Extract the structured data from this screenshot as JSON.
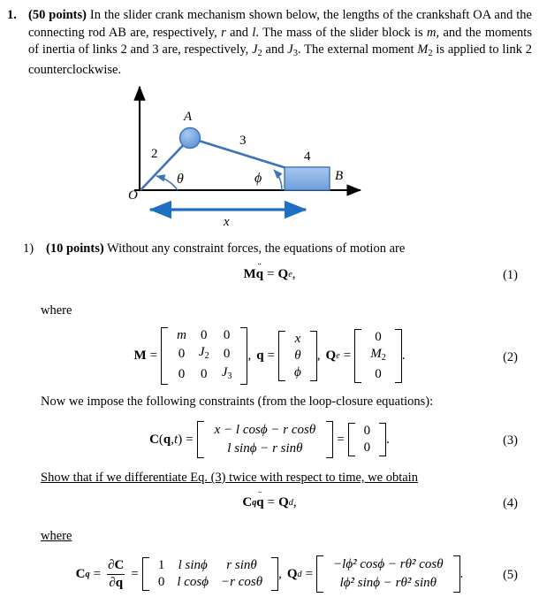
{
  "problem": {
    "number": "1.",
    "points_label": "(50 points)",
    "text_part1": " In the slider crank mechanism shown below, the lengths of the crankshaft OA and the connecting rod AB are, respectively, ",
    "var_r": "r",
    "text_and1": " and ",
    "var_l": "l",
    "text_part2": ". The mass of the slider block is ",
    "var_m": "m",
    "text_part3": ", and the moments of inertia of links 2 and 3 are, respectively, ",
    "var_J2": "J",
    "sub_2": "2",
    "text_and2": " and ",
    "var_J3": "J",
    "sub_3": "3",
    "text_part4": ". The external moment ",
    "var_M2": "M",
    "sub_M2": "2",
    "text_part5": " is applied to link 2 counterclockwise."
  },
  "figure": {
    "label_O": "O",
    "label_A": "A",
    "label_B": "B",
    "label_link2": "2",
    "label_link3": "3",
    "label_link4": "4",
    "label_theta": "θ",
    "label_phi": "ϕ",
    "label_x": "x",
    "colors": {
      "link": "#3b72b8",
      "block_fill": "#8cb3e8",
      "block_stroke": "#3b72b8",
      "joint_fill": "#7aa9e0",
      "joint_stroke": "#3b72b8",
      "arrow": "#1f6fc4",
      "axis": "#000000"
    }
  },
  "subpart": {
    "number": "1)",
    "points_label": "(10 points)",
    "text": " Without any constraint forces, the equations of motion are"
  },
  "where1": "where",
  "constraints_text": "Now we impose the following constraints (from the loop-closure equations):",
  "show_text": "Show that if we differentiate Eq. (3) twice with respect to time, we obtain",
  "where2": "where",
  "equations": {
    "eq1": {
      "number": "(1)",
      "M": "M",
      "q": "q",
      "ddot": "¨",
      "equals": "=",
      "Q": "Q",
      "sub_e": "e",
      "comma": ","
    },
    "eq2": {
      "number": "(2)",
      "M_label": "M",
      "equals": "=",
      "M_rows": [
        [
          "m",
          "0",
          "0"
        ],
        [
          "0",
          "J₂",
          "0"
        ],
        [
          "0",
          "0",
          "J₃"
        ]
      ],
      "M_cells": [
        [
          {
            "t": "m",
            "style": "it"
          },
          {
            "t": "0",
            "style": "rm"
          },
          {
            "t": "0",
            "style": "rm"
          }
        ],
        [
          {
            "t": "0",
            "style": "rm"
          },
          {
            "t": "J",
            "style": "it",
            "sub": "2"
          },
          {
            "t": "0",
            "style": "rm"
          }
        ],
        [
          {
            "t": "0",
            "style": "rm"
          },
          {
            "t": "0",
            "style": "rm"
          },
          {
            "t": "J",
            "style": "it",
            "sub": "3"
          }
        ]
      ],
      "comma1": ",",
      "q_label": "q",
      "q_cells": [
        {
          "t": "x",
          "style": "it"
        },
        {
          "t": "θ",
          "style": "it"
        },
        {
          "t": "ϕ",
          "style": "it"
        }
      ],
      "comma2": ",",
      "Q_label": "Q",
      "Q_sub": "e",
      "Qe_cells": [
        {
          "t": "0",
          "style": "rm"
        },
        {
          "t": "M",
          "style": "it",
          "sub": "2"
        },
        {
          "t": "0",
          "style": "rm"
        }
      ],
      "period": "."
    },
    "eq3": {
      "number": "(3)",
      "C_label": "C",
      "arg_open": "(",
      "arg_q": "q",
      "arg_comma": ",",
      "arg_t": "t",
      "arg_close": ")",
      "equals1": "=",
      "row1": "x − l cosϕ − r cosθ",
      "row2": "l sinϕ − r sinθ",
      "equals2": "=",
      "zero_rows": [
        "0",
        "0"
      ],
      "period": "."
    },
    "eq4": {
      "number": "(4)",
      "C_label": "C",
      "C_sub": "q",
      "q": "q",
      "ddot": "¨",
      "equals": "=",
      "Q": "Q",
      "Q_sub": "d",
      "comma": ","
    },
    "eq5": {
      "number": "(5)",
      "Cq_label": "C",
      "Cq_sub": "q",
      "equals1": "=",
      "frac_num_partial": "∂",
      "frac_num_C": "C",
      "frac_den_partial": "∂",
      "frac_den_q": "q",
      "equals2": "=",
      "Cq_rows": [
        [
          "1",
          "l sinϕ",
          "r sinθ"
        ],
        [
          "0",
          "l cosϕ",
          "−r cosθ"
        ]
      ],
      "comma": ",",
      "Qd_label": "Q",
      "Qd_sub": "d",
      "equals3": "=",
      "Qd_row1": "−lϕ̇² cosϕ − rθ̇² cosθ",
      "Qd_row2": "lϕ̇² sinϕ − rθ̇² sinθ",
      "period": "."
    }
  }
}
